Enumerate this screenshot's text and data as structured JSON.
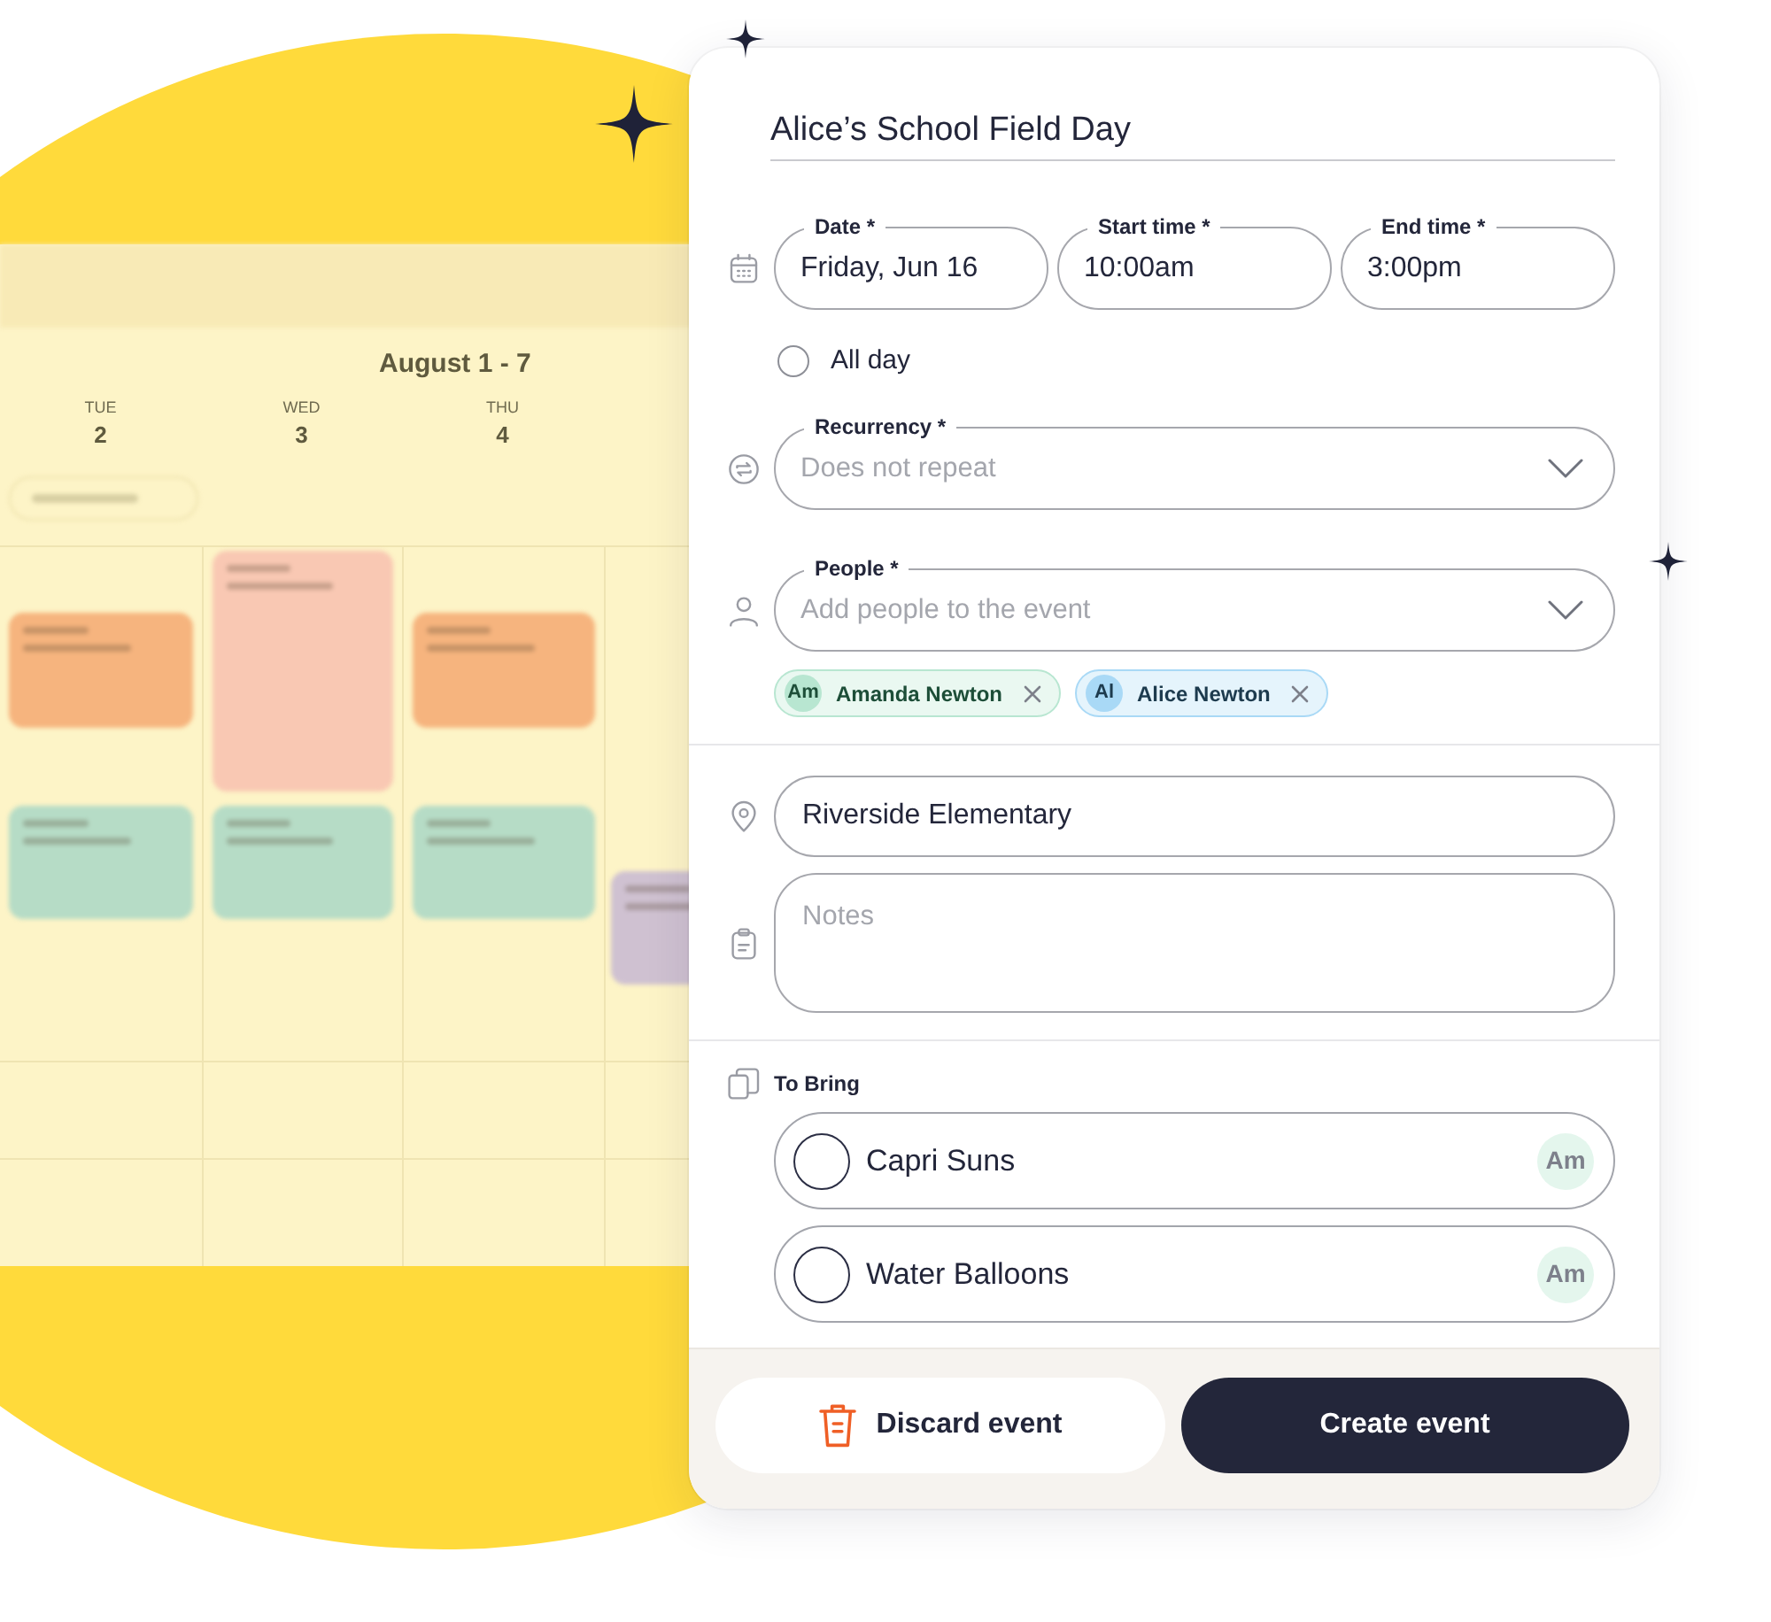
{
  "background": {
    "calendar": {
      "title": "August 1 - 7",
      "columns": [
        {
          "weekday": "TUE",
          "day": "2",
          "events": [
            {
              "color": "#f6b47e"
            },
            {
              "color": "#b6dcc6"
            }
          ]
        },
        {
          "weekday": "WED",
          "day": "3",
          "events": [
            {
              "color": "#f9c8b3"
            },
            {
              "color": "#b6dcc6"
            }
          ]
        },
        {
          "weekday": "THU",
          "day": "4",
          "events": [
            {
              "color": "#f6b47e"
            },
            {
              "color": "#b6dcc6"
            }
          ]
        },
        {
          "events": [
            {
              "color": "#cfc1d1"
            }
          ]
        }
      ]
    }
  },
  "form": {
    "title": "Alice’s School Field Day",
    "date_fields": [
      {
        "label": "Date *",
        "value": "Friday, Jun 16"
      },
      {
        "label": "Start time *",
        "value": "10:00am"
      },
      {
        "label": "End time *",
        "value": "3:00pm"
      }
    ],
    "all_day": {
      "label": "All day",
      "checked": false
    },
    "recurrency": {
      "label": "Recurrency *",
      "placeholder": "Does not repeat"
    },
    "people": {
      "label": "People *",
      "placeholder": "Add people to the event",
      "chips": [
        {
          "initials": "Am",
          "name": "Amanda Newton",
          "color": "#b8e6d1"
        },
        {
          "initials": "Al",
          "name": "Alice Newton",
          "color": "#a9d9f6"
        }
      ]
    },
    "location": {
      "value": "Riverside Elementary"
    },
    "notes": {
      "placeholder": "Notes"
    },
    "to_bring": {
      "heading": "To Bring",
      "items": [
        {
          "label": "Capri Suns",
          "checked": false,
          "assignee": "Am"
        },
        {
          "label": "Water Balloons",
          "checked": false,
          "assignee": "Am"
        }
      ]
    },
    "buttons": [
      {
        "kind": "discard",
        "label": "Discard event"
      },
      {
        "kind": "create",
        "label": "Create event"
      }
    ]
  }
}
